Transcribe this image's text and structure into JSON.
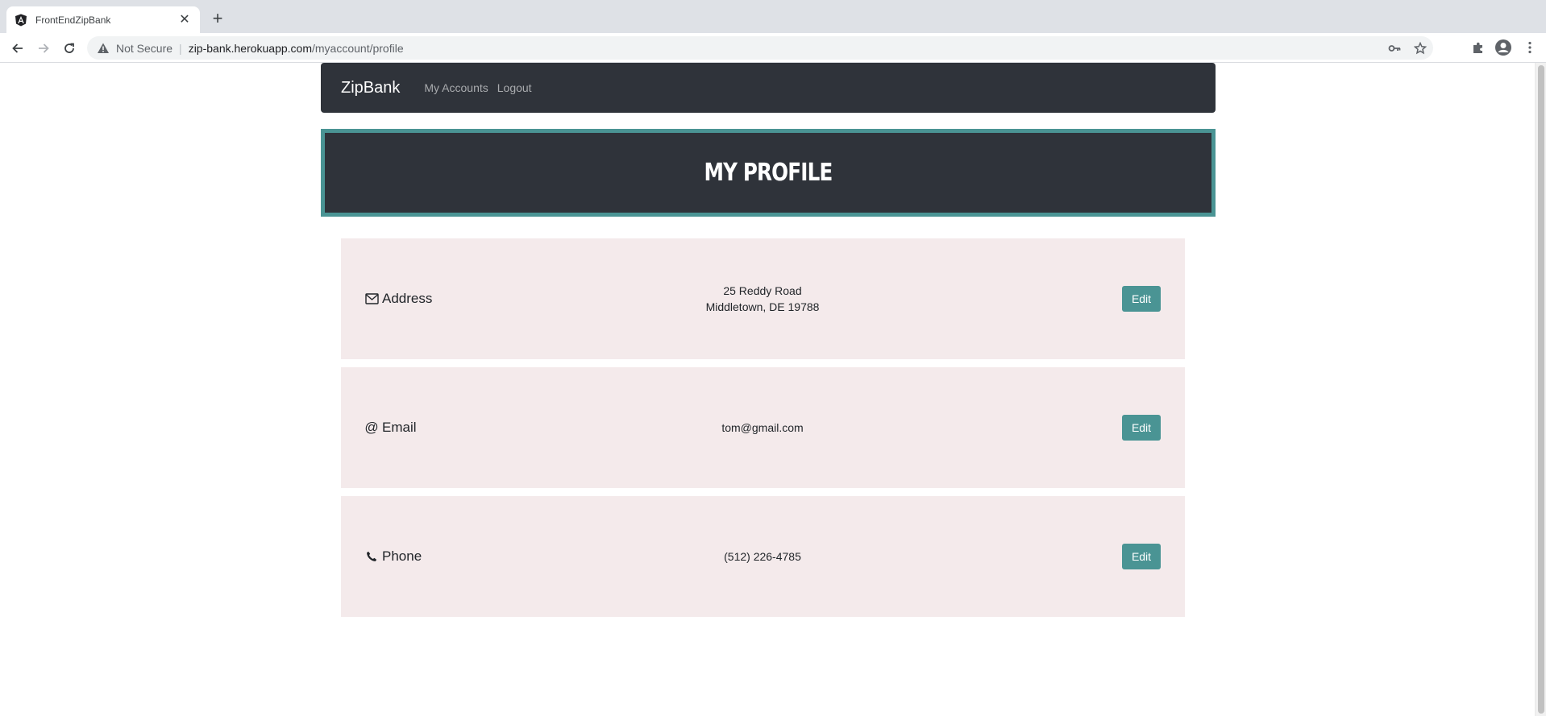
{
  "browser": {
    "tab_title": "FrontEndZipBank",
    "security_label": "Not Secure",
    "url_host": "zip-bank.herokuapp.com",
    "url_path": "/myaccount/profile"
  },
  "navbar": {
    "brand": "ZipBank",
    "links": [
      "My Accounts",
      "Logout"
    ]
  },
  "hero": {
    "title": "My Profile"
  },
  "profile": {
    "address": {
      "label": "Address",
      "icon": "envelope-icon",
      "line1": "25 Reddy Road",
      "line2": "Middletown, DE 19788",
      "edit_label": "Edit"
    },
    "email": {
      "label": "Email",
      "icon": "at-icon",
      "icon_glyph": "@",
      "value": "tom@gmail.com",
      "edit_label": "Edit"
    },
    "phone": {
      "label": "Phone",
      "icon": "phone-icon",
      "value": "(512) 226-4785",
      "edit_label": "Edit"
    }
  },
  "colors": {
    "navbar_bg": "#2f333a",
    "accent_teal": "#4a9494",
    "card_bg": "#f4eaeb"
  }
}
